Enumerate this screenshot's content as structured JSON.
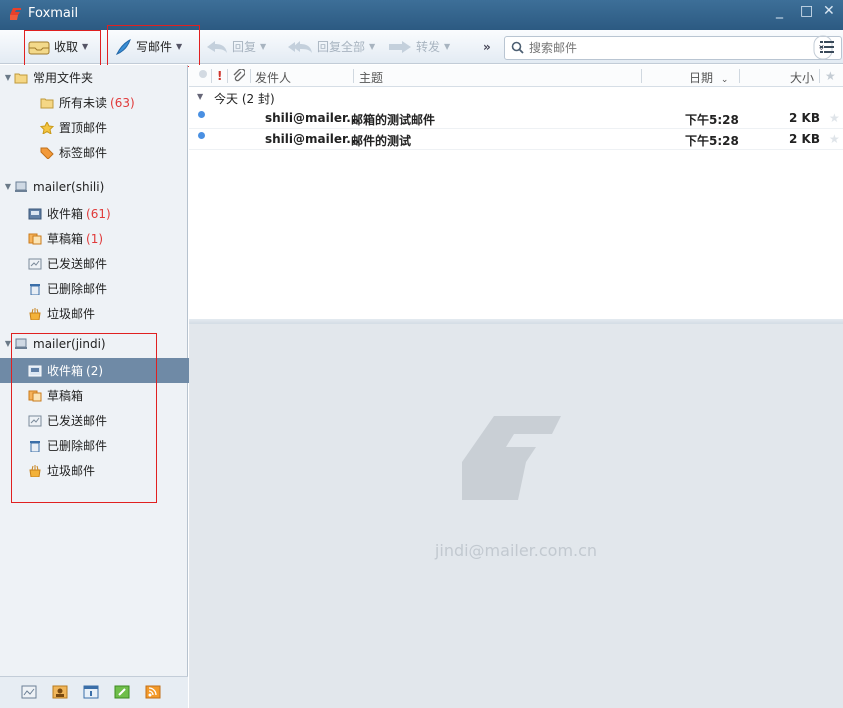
{
  "window": {
    "title": "Foxmail",
    "controls": [
      "_",
      "□",
      "✕"
    ]
  },
  "toolbar": {
    "receive": "收取",
    "compose": "写邮件",
    "reply": "回复",
    "reply_all": "回复全部",
    "forward": "转发",
    "more": "»",
    "search_placeholder": "搜索邮件",
    "collapse_glyph": "«"
  },
  "sidebar": {
    "common": {
      "label": "常用文件夹",
      "items": [
        {
          "label": "所有未读",
          "count": "(63)"
        },
        {
          "label": "置顶邮件",
          "count": ""
        },
        {
          "label": "标签邮件",
          "count": ""
        }
      ]
    },
    "account1": {
      "label": "mailer(shili)",
      "items": [
        {
          "label": "收件箱",
          "count": "(61)"
        },
        {
          "label": "草稿箱",
          "count": "(1)"
        },
        {
          "label": "已发送邮件",
          "count": ""
        },
        {
          "label": "已删除邮件",
          "count": ""
        },
        {
          "label": "垃圾邮件",
          "count": ""
        }
      ]
    },
    "account2": {
      "label": "mailer(jindi)",
      "items": [
        {
          "label": "收件箱",
          "count": "(2)"
        },
        {
          "label": "草稿箱",
          "count": ""
        },
        {
          "label": "已发送邮件",
          "count": ""
        },
        {
          "label": "已删除邮件",
          "count": ""
        },
        {
          "label": "垃圾邮件",
          "count": ""
        }
      ]
    }
  },
  "list": {
    "columns": {
      "from": "发件人",
      "subject": "主题",
      "date": "日期",
      "size": "大小"
    },
    "group": "今天 (2 封)",
    "rows": [
      {
        "from": "shili@mailer...",
        "subject": "邮箱的测试邮件",
        "date": "下午5:28",
        "size": "2 KB"
      },
      {
        "from": "shili@mailer...",
        "subject": "邮件的测试",
        "date": "下午5:28",
        "size": "2 KB"
      }
    ]
  },
  "preview": {
    "account_email": "jindi@mailer.com.cn"
  },
  "colors": {
    "titlebar": "#2c5a82",
    "selected": "#6f8aa6",
    "unread_count": "#e03a3a",
    "highlight_box": "#e02020"
  }
}
